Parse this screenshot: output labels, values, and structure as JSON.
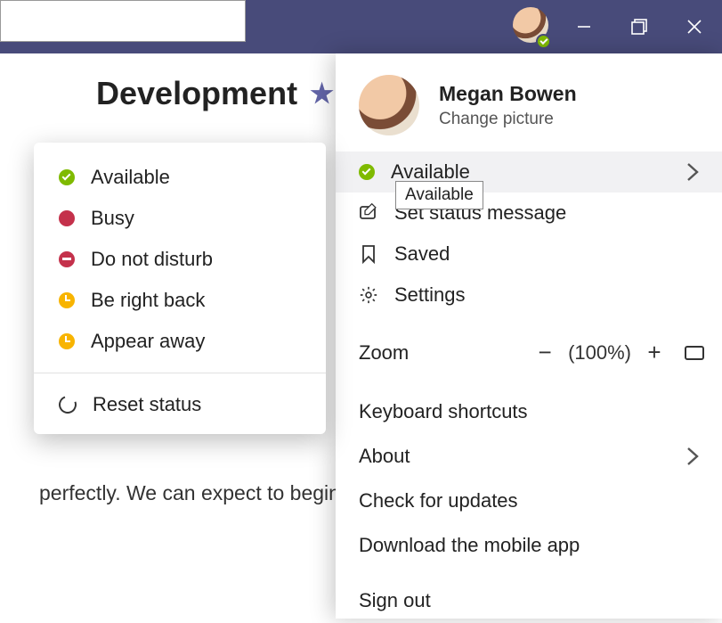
{
  "page": {
    "title": "Development",
    "body_snippet": "perfectly. We can expect to begin pro"
  },
  "profile": {
    "name": "Megan Bowen",
    "change_picture": "Change picture"
  },
  "flyout": {
    "status_label": "Available",
    "tooltip": "Available",
    "set_status_message": "Set status message",
    "saved": "Saved",
    "settings": "Settings",
    "zoom_label": "Zoom",
    "zoom_pct": "(100%)",
    "keyboard_shortcuts": "Keyboard shortcuts",
    "about": "About",
    "check_updates": "Check for updates",
    "download_mobile": "Download the mobile app",
    "sign_out": "Sign out"
  },
  "status_menu": {
    "available": "Available",
    "busy": "Busy",
    "dnd": "Do not disturb",
    "brb": "Be right back",
    "appear_away": "Appear away",
    "reset": "Reset status"
  }
}
